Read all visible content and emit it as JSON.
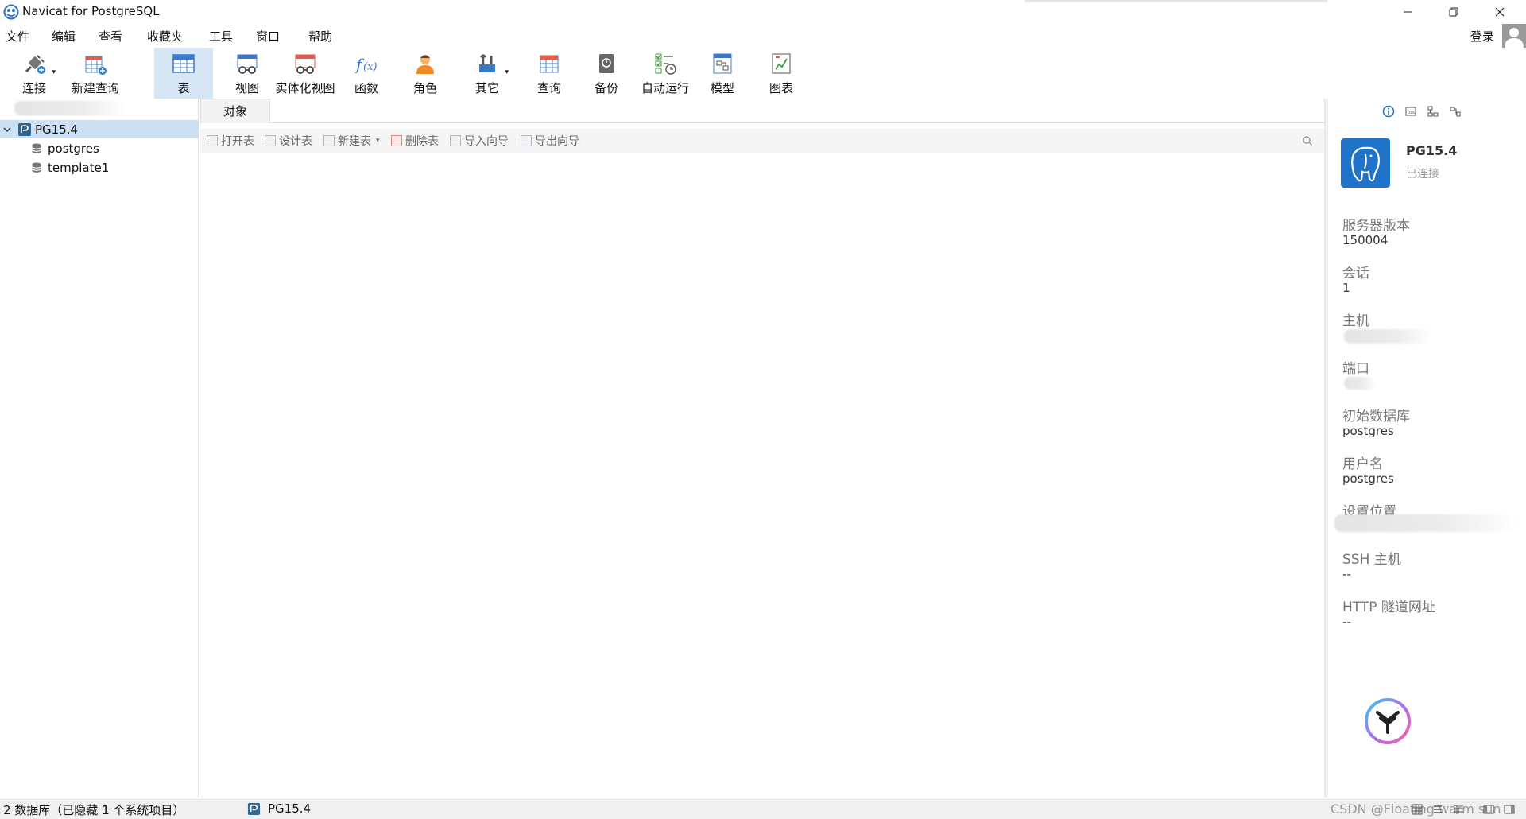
{
  "window": {
    "title": "Navicat for PostgreSQL",
    "app_icon": "navicat-logo-icon",
    "controls": [
      "minimize-icon",
      "restore-icon",
      "close-icon"
    ]
  },
  "menubar": {
    "items": [
      "文件",
      "编辑",
      "查看",
      "收藏夹",
      "工具",
      "窗口",
      "帮助"
    ],
    "login_label": "登录",
    "avatar_icon": "user-avatar-icon"
  },
  "toolbar": {
    "items": [
      {
        "label": "连接",
        "icon": "plug-connection-icon",
        "has_dropdown": true
      },
      {
        "label": "新建查询",
        "icon": "new-query-icon"
      },
      {
        "label": "表",
        "icon": "table-icon",
        "active": true
      },
      {
        "label": "视图",
        "icon": "view-icon"
      },
      {
        "label": "实体化视图",
        "icon": "materialized-view-icon"
      },
      {
        "label": "函数",
        "icon": "function-icon"
      },
      {
        "label": "角色",
        "icon": "role-user-icon"
      },
      {
        "label": "其它",
        "icon": "tools-icon",
        "has_dropdown": true
      },
      {
        "label": "查询",
        "icon": "query-icon"
      },
      {
        "label": "备份",
        "icon": "backup-icon"
      },
      {
        "label": "自动运行",
        "icon": "automation-icon"
      },
      {
        "label": "模型",
        "icon": "model-icon"
      },
      {
        "label": "图表",
        "icon": "chart-icon"
      }
    ]
  },
  "tree": {
    "connection": {
      "label": "PG15.4",
      "icon": "postgresql-connection-icon",
      "expanded": true
    },
    "databases": [
      {
        "label": "postgres",
        "icon": "database-icon"
      },
      {
        "label": "template1",
        "icon": "database-icon"
      }
    ]
  },
  "object_panel": {
    "tab_label": "对象",
    "toolbar": [
      {
        "label": "打开表",
        "icon": "open-table-icon"
      },
      {
        "label": "设计表",
        "icon": "design-table-icon"
      },
      {
        "label": "新建表",
        "icon": "new-table-icon",
        "has_dropdown": true
      },
      {
        "label": "删除表",
        "icon": "delete-table-icon"
      },
      {
        "label": "导入向导",
        "icon": "import-wizard-icon"
      },
      {
        "label": "导出向导",
        "icon": "export-wizard-icon"
      }
    ],
    "search_icon": "search-icon"
  },
  "info_panel": {
    "header_icons": [
      "info-icon",
      "ddl-icon",
      "dependency-icon",
      "er-layout-icon"
    ],
    "connection_name": "PG15.4",
    "connection_status": "已连接",
    "fields": [
      {
        "label": "服务器版本",
        "value": "150004"
      },
      {
        "label": "会话",
        "value": "1"
      },
      {
        "label": "主机",
        "value": ""
      },
      {
        "label": "端口",
        "value": ""
      },
      {
        "label": "初始数据库",
        "value": "postgres"
      },
      {
        "label": "用户名",
        "value": "postgres"
      },
      {
        "label": "设置位置",
        "value": ""
      },
      {
        "label": "SSH 主机",
        "value": "--"
      },
      {
        "label": "HTTP 隧道网址",
        "value": "--"
      }
    ]
  },
  "statusbar": {
    "db_count": "2 数据库（已隐藏 1 个系统项目）",
    "connection": "PG15.4",
    "watermark": "CSDN @Floating warm sun"
  },
  "colors": {
    "selection": "#cce0f4",
    "active_tool": "#d7e6f5",
    "pg_blue": "#336791",
    "brand_blue": "#1f74c9"
  }
}
